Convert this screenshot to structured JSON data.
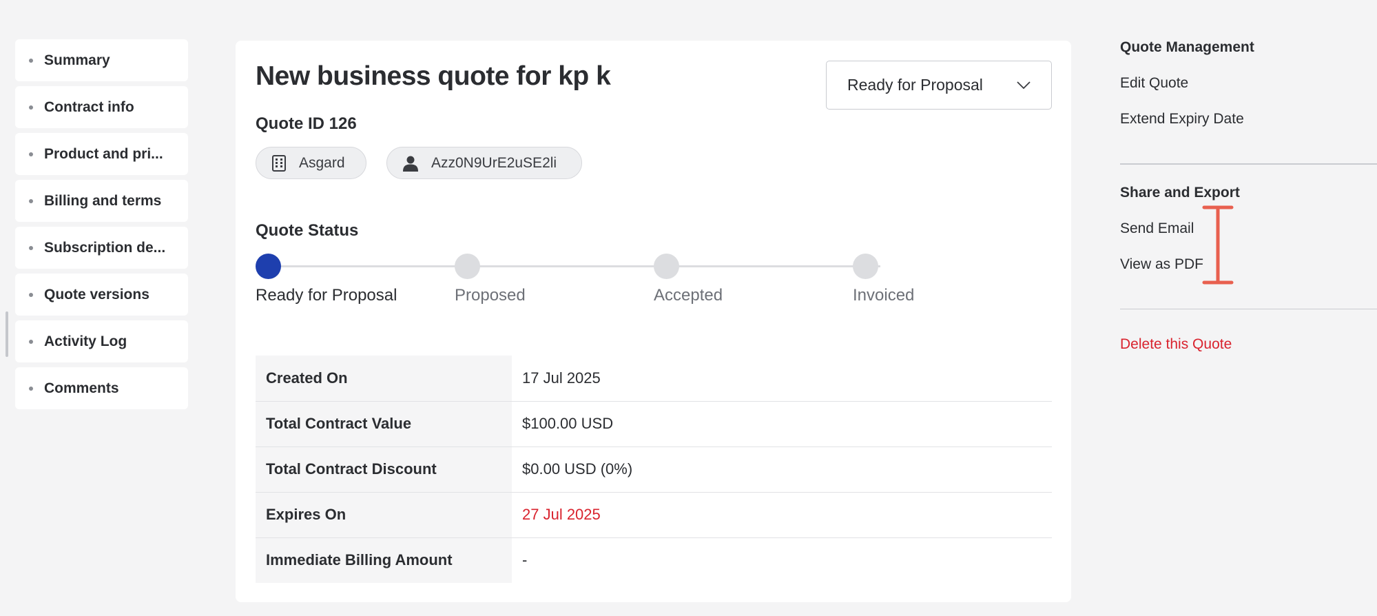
{
  "leftnav": {
    "items": [
      {
        "label": "Summary"
      },
      {
        "label": "Contract info"
      },
      {
        "label": "Product and pri..."
      },
      {
        "label": "Billing and terms"
      },
      {
        "label": "Subscription de..."
      },
      {
        "label": "Quote versions"
      },
      {
        "label": "Activity Log"
      },
      {
        "label": "Comments"
      }
    ]
  },
  "quote": {
    "title": "New business quote for kp k",
    "status_value": "Ready for Proposal",
    "id_label": "Quote ID 126",
    "org_chip": {
      "label": "Asgard",
      "icon": "building-icon"
    },
    "user_chip": {
      "label": "Azz0N9UrE2uSE2li",
      "icon": "person-icon"
    },
    "status_section_title": "Quote Status",
    "steps": [
      {
        "label": "Ready for Proposal",
        "active": true
      },
      {
        "label": "Proposed",
        "active": false
      },
      {
        "label": "Accepted",
        "active": false
      },
      {
        "label": "Invoiced",
        "active": false
      }
    ],
    "details": [
      {
        "key": "Created On",
        "value": "17 Jul 2025"
      },
      {
        "key": "Total Contract Value",
        "value": "$100.00 USD"
      },
      {
        "key": "Total Contract Discount",
        "value": "$0.00 USD (0%)"
      },
      {
        "key": "Expires On",
        "value": "27 Jul 2025",
        "color": "#d9232e"
      },
      {
        "key": "Immediate Billing Amount",
        "value": "-"
      }
    ]
  },
  "rightpanel": {
    "management_heading": "Quote Management",
    "edit_quote": "Edit Quote",
    "extend_expiry": "Extend Expiry Date",
    "share_heading": "Share and Export",
    "send_email": "Send Email",
    "view_pdf": "View as PDF",
    "delete_quote": "Delete this Quote"
  },
  "colors": {
    "accent": "#1e3fae",
    "danger": "#d9232e",
    "cursor": "#e8604f"
  }
}
